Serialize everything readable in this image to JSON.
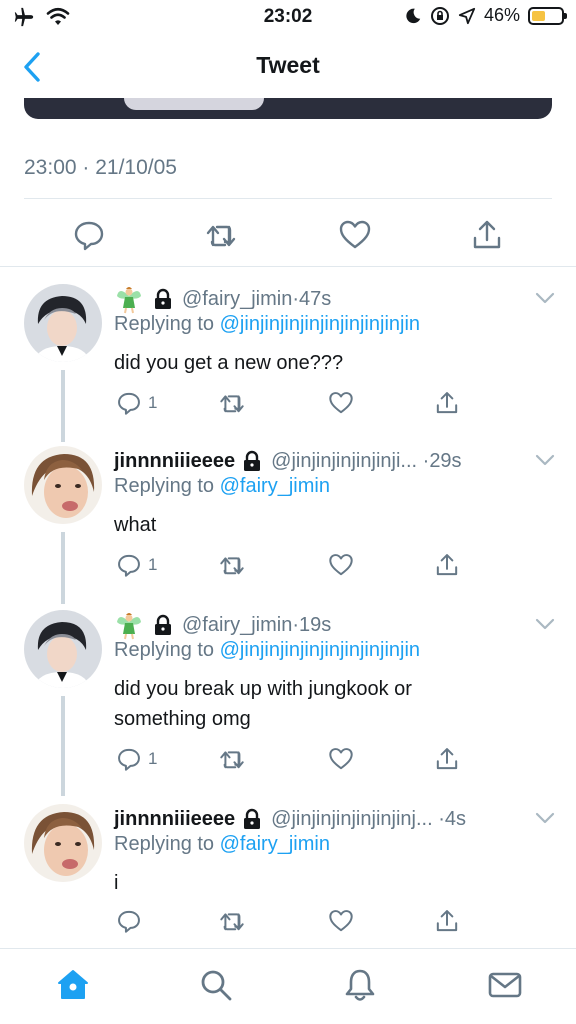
{
  "status_bar": {
    "time": "23:02",
    "battery_percent": "46%",
    "battery_level": 0.46,
    "icons": [
      "airplane-icon",
      "wifi-icon",
      "moon-icon",
      "orientation-lock-icon",
      "location-icon",
      "battery-icon"
    ]
  },
  "nav": {
    "title": "Tweet",
    "back_icon": "chevron-left-icon"
  },
  "tweet": {
    "timestamp": "23:00 · 21/10/05",
    "actions": [
      "reply-icon",
      "retweet-icon",
      "like-icon",
      "share-icon"
    ]
  },
  "replies": [
    {
      "name": "",
      "emoji": "fairy",
      "handle": "@fairy_jimin",
      "dot": "·",
      "age": "47s",
      "replying_prefix": "Replying to",
      "replying_to": "@jinjinjinjinjinjinjinjinjin",
      "text": "did you get a new one???",
      "reply_count": "1"
    },
    {
      "name": "jinnnniiieeee",
      "emoji": "",
      "handle": "@jinjinjinjinjinji...",
      "dot": "·",
      "age": "29s",
      "replying_prefix": "Replying to",
      "replying_to": "@fairy_jimin",
      "text": "what",
      "reply_count": "1"
    },
    {
      "name": "",
      "emoji": "fairy",
      "handle": "@fairy_jimin",
      "dot": "·",
      "age": "19s",
      "replying_prefix": "Replying to",
      "replying_to": "@jinjinjinjinjinjinjinjinjin",
      "text": "did you break up with jungkook or something omg",
      "reply_count": "1"
    },
    {
      "name": "jinnnniiieeee",
      "emoji": "",
      "handle": "@jinjinjinjinjinjinj...",
      "dot": "·",
      "age": "4s",
      "replying_prefix": "Replying to",
      "replying_to": "@fairy_jimin",
      "text": "i",
      "reply_count": ""
    }
  ],
  "tab_bar": {
    "tabs": [
      "home-icon",
      "search-icon",
      "notifications-icon",
      "messages-icon"
    ],
    "active": "home-icon"
  },
  "colors": {
    "accent": "#1da1f2",
    "text": "#14171a",
    "secondary_text": "#657786",
    "divider": "#e1e8ed",
    "battery_fill": "#f6c342"
  }
}
